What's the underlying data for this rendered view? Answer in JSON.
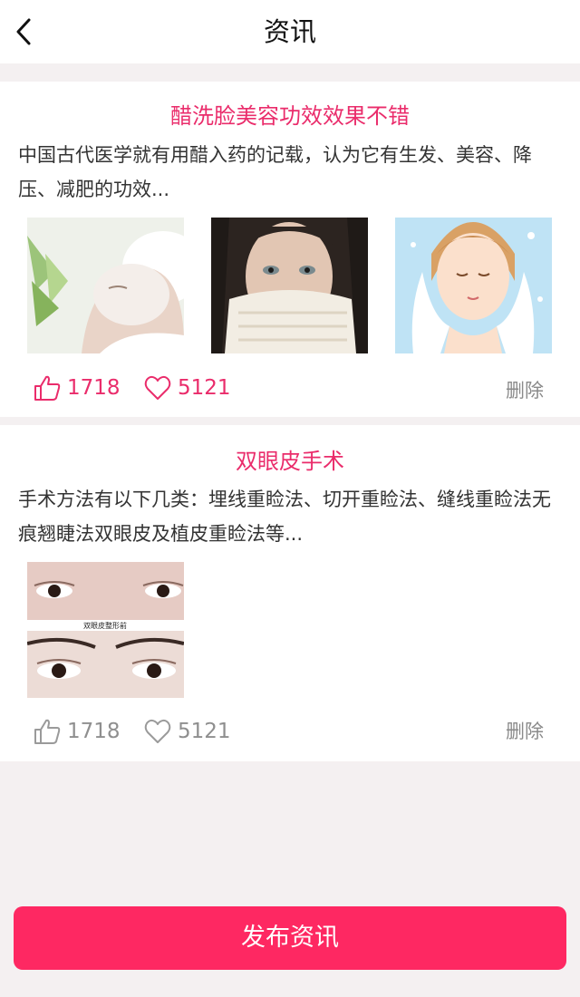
{
  "header": {
    "title": "资讯",
    "back_icon": "chevron-left-icon"
  },
  "colors": {
    "accent": "#fe2862",
    "title_pink": "#ea2c6b",
    "page_bg": "#f4f0f1",
    "muted_gray": "#8f8f8f"
  },
  "posts": [
    {
      "title": "醋洗脸美容功效效果不错",
      "description": "中国古代医学就有用醋入药的记载，认为它有生发、美容、降压、减肥的功效...",
      "images": [
        "facial-mask-spa-photo",
        "woman-towel-face-photo",
        "cartoon-girl-washing-face-illustration"
      ],
      "likes": "1718",
      "favorites": "5121",
      "liked": true,
      "delete_label": "删除"
    },
    {
      "title": "双眼皮手术",
      "description": "手术方法有以下几类：埋线重睑法、切开重睑法、缝线重睑法无痕翘睫法双眼皮及植皮重睑法等...",
      "images": [
        "double-eyelid-before-after-photo"
      ],
      "image_caption": "双眼皮整形前",
      "likes": "1718",
      "favorites": "5121",
      "liked": false,
      "delete_label": "删除"
    }
  ],
  "footer": {
    "publish_label": "发布资讯"
  }
}
